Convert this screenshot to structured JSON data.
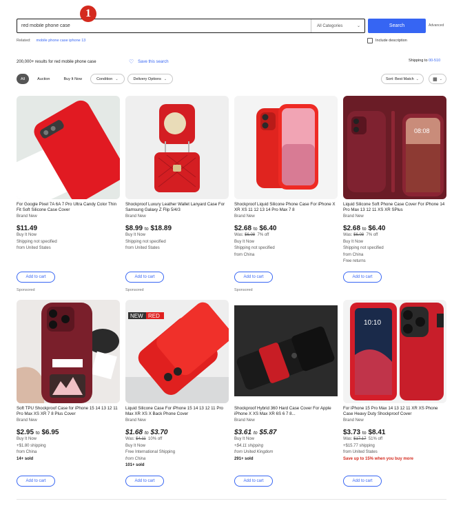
{
  "header": {
    "search_value": "red mobile phone case",
    "category": "All Categories",
    "search_button": "Search",
    "advanced": "Advanced",
    "marker": "1"
  },
  "related": {
    "label": "Related:",
    "links": [
      "mobile phone case iphone 13"
    ]
  },
  "include_description": "Include description",
  "results": {
    "count": "200,000+ results for red mobile phone case",
    "save_search": "Save this search"
  },
  "ship_to": {
    "label": "Shipping to",
    "value": "00-510"
  },
  "filters": [
    "All",
    "Auction",
    "Buy It Now",
    "Condition",
    "Delivery Options"
  ],
  "sort": "Sort: Best Match",
  "add_to_cart": "Add to cart",
  "sponsored": "Sponsored",
  "products": [
    {
      "title": "For Google Pixel 7A 6A 7 Pro Ultra Candy Color Thin Fit Soft Silicone Case Cover",
      "condition": "Brand New",
      "price": "$11.49",
      "price_to": "",
      "price_italic": false,
      "lines": [
        [
          "Buy It Now",
          ""
        ],
        [
          "Shipping not specified",
          ""
        ],
        [
          "from United States",
          ""
        ]
      ],
      "colors": {
        "bg": "#e4e9e6",
        "item": "#e11a22"
      }
    },
    {
      "title": "Shockproof Luxury Leather Wallet Lanyard Case For Samsung Galaxy Z Flip 5/4/3",
      "condition": "Brand New",
      "price": "$8.99",
      "price_to": "$18.89",
      "price_italic": false,
      "lines": [
        [
          "Buy It Now",
          ""
        ],
        [
          "Shipping not specified",
          ""
        ],
        [
          "from United States",
          ""
        ]
      ],
      "colors": {
        "bg": "#efefef",
        "item": "#d41e22"
      }
    },
    {
      "title": "Shockproof Liquid Silicone Phone Case For iPhone X XR XS 11 12 13 14 Pro Max 7 8",
      "condition": "Brand New",
      "price": "$2.68",
      "price_to": "$6.40",
      "price_italic": false,
      "was": "$6.08",
      "off": "7% off",
      "lines": [
        [
          "Buy It Now",
          ""
        ],
        [
          "Shipping not specified",
          ""
        ],
        [
          "from China",
          ""
        ]
      ],
      "colors": {
        "bg": "#f4f4f4",
        "item": "#e0241f"
      }
    },
    {
      "title": "Liquid Silicone Soft Phone Case Cover For iPhone 14 Pro Max 13 12 11 XS XR SPlus",
      "condition": "Brand New",
      "price": "$2.68",
      "price_to": "$6.40",
      "price_italic": false,
      "was": "$6.08",
      "off": "7% off",
      "lines": [
        [
          "Buy It Now",
          ""
        ],
        [
          "Shipping not specified",
          ""
        ],
        [
          "from China",
          ""
        ],
        [
          "Free returns",
          ""
        ]
      ],
      "colors": {
        "bg": "#6a1c26",
        "item": "#7f2230"
      }
    },
    {
      "title": "Soft TPU Shockproof Case for iPhone 15 14 13 12 11 Pro Max XS XR 7 8 Plus Cover",
      "condition": "Brand New",
      "price": "$2.95",
      "price_to": "$6.95",
      "price_italic": false,
      "lines": [
        [
          "Buy It Now",
          ""
        ],
        [
          "+$1.80 shipping",
          ""
        ],
        [
          "from China",
          ""
        ],
        [
          "14+ sold",
          "bold"
        ]
      ],
      "colors": {
        "bg": "#ece9e7",
        "item": "#7a1f2b"
      }
    },
    {
      "title": "Liquid Silicone Case For iPhone 15 14 13 12 11 Pro Max XR XS X Back Phone Cover",
      "condition": "Brand New",
      "price": "$1.68",
      "price_to": "$3.70",
      "price_italic": true,
      "was": "$4.11",
      "off": "10% off",
      "badge_left": "NEW",
      "badge_right": "RED",
      "lines": [
        [
          "Buy It Now",
          ""
        ],
        [
          "Free International Shipping",
          ""
        ],
        [
          "from China",
          "italic"
        ],
        [
          "101+ sold",
          "bold"
        ]
      ],
      "colors": {
        "bg": "#eeeeee",
        "item": "#e0201f"
      }
    },
    {
      "title": "Shockproof Hybrid 360 Hard Case Cover For Apple iPhone X XS Max XR 6S 6 7 8...",
      "condition": "Brand New",
      "price": "$3.61",
      "price_to": "$5.87",
      "price_italic": true,
      "lines": [
        [
          "Buy It Now",
          ""
        ],
        [
          "+$4.11 shipping",
          "italic"
        ],
        [
          "from United Kingdom",
          "italic"
        ],
        [
          "291+ sold",
          "bold"
        ]
      ],
      "colors": {
        "bg": "#2b2b2b",
        "item": "#c81d25"
      }
    },
    {
      "title": "For iPhone 15 Pro Max 14 13 12 11 XR XS Phone Case Heavy Duty Shockproof Cover",
      "condition": "Brand New",
      "price": "$3.73",
      "price_to": "$8.41",
      "price_italic": false,
      "was": "$17.17",
      "off": "51% off",
      "lines": [
        [
          "+$15.77 shipping",
          ""
        ],
        [
          "from United States",
          ""
        ]
      ],
      "promo": "Save up to 15% when you buy more",
      "colors": {
        "bg": "#f3f3f3",
        "item": "#d41e2a"
      }
    }
  ]
}
